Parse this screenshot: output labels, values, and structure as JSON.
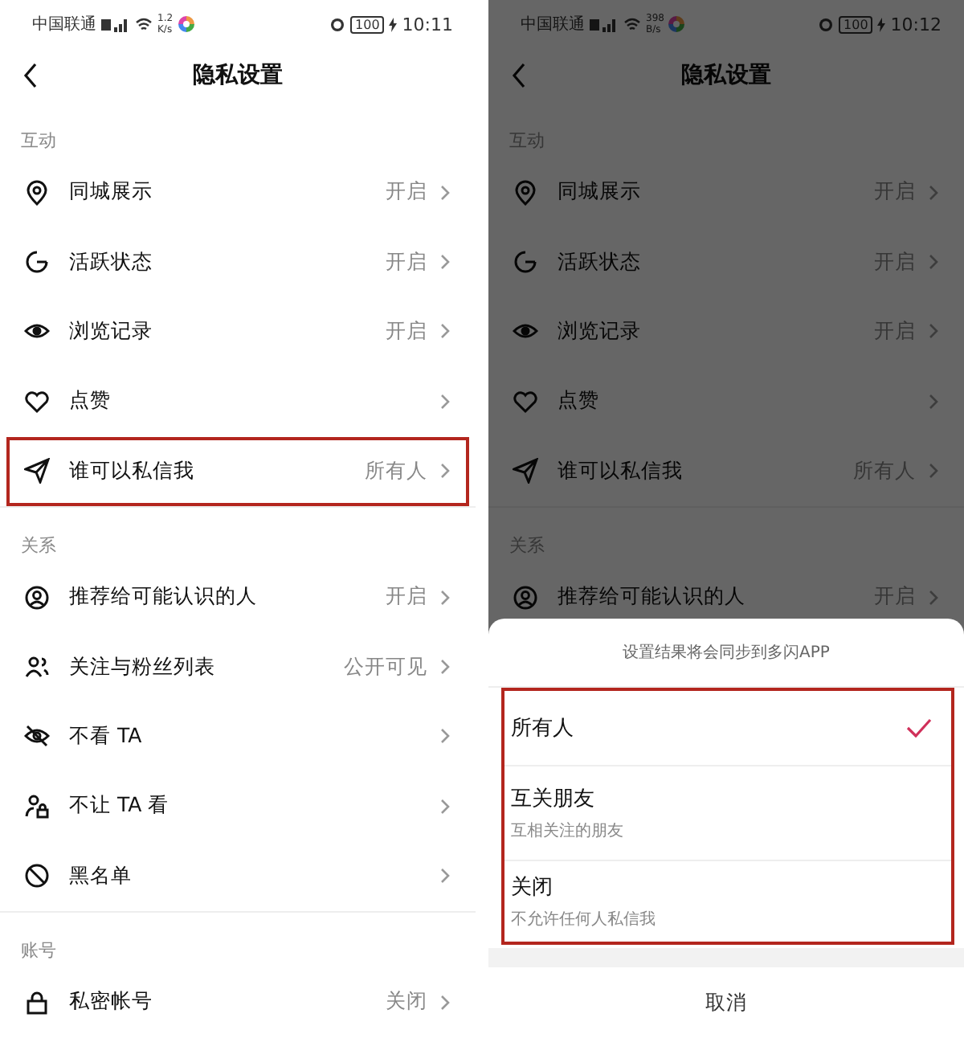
{
  "screens": [
    {
      "status_bar": {
        "carrier": "中国联通",
        "speed_value": "1.2",
        "speed_unit": "K/s",
        "battery": "100",
        "time": "10:11"
      },
      "title": "隐私设置",
      "dimmed": false,
      "sections": [
        {
          "label": "互动",
          "items": [
            {
              "label": "同城展示",
              "value": "开启",
              "highlighted": false
            },
            {
              "label": "活跃状态",
              "value": "开启",
              "highlighted": false
            },
            {
              "label": "浏览记录",
              "value": "开启",
              "highlighted": false
            },
            {
              "label": "点赞",
              "highlighted": false
            },
            {
              "label": "谁可以私信我",
              "value": "所有人",
              "highlighted": true
            }
          ]
        },
        {
          "label": "关系",
          "items": [
            {
              "label": "推荐给可能认识的人",
              "value": "开启",
              "highlighted": false
            },
            {
              "label": "关注与粉丝列表",
              "value": "公开可见",
              "highlighted": false
            },
            {
              "label": "不看 TA",
              "highlighted": false
            },
            {
              "label": "不让 TA 看",
              "highlighted": false
            },
            {
              "label": "黑名单",
              "highlighted": false
            }
          ]
        },
        {
          "label": "账号",
          "items": [
            {
              "label": "私密帐号",
              "value": "关闭",
              "highlighted": false
            }
          ]
        }
      ]
    },
    {
      "status_bar": {
        "carrier": "中国联通",
        "speed_value": "398",
        "speed_unit": "B/s",
        "battery": "100",
        "time": "10:12"
      },
      "title": "隐私设置",
      "dimmed": true,
      "sections": [
        {
          "label": "互动",
          "items": [
            {
              "label": "同城展示",
              "value": "开启",
              "highlighted": false
            },
            {
              "label": "活跃状态",
              "value": "开启",
              "highlighted": false
            },
            {
              "label": "浏览记录",
              "value": "开启",
              "highlighted": false
            },
            {
              "label": "点赞",
              "highlighted": false
            },
            {
              "label": "谁可以私信我",
              "value": "所有人",
              "highlighted": false
            }
          ]
        },
        {
          "label": "关系",
          "items": [
            {
              "label": "推荐给可能认识的人",
              "value": "开启",
              "highlighted": false
            }
          ]
        }
      ],
      "sheet": {
        "note": "设置结果将会同步到多闪APP",
        "highlighted": true,
        "options": [
          {
            "label": "所有人",
            "selected": true
          },
          {
            "label": "互关朋友",
            "description": "互相关注的朋友",
            "selected": false
          },
          {
            "label": "关闭",
            "description": "不允许任何人私信我",
            "selected": false
          }
        ],
        "cancel": "取消"
      }
    }
  ]
}
